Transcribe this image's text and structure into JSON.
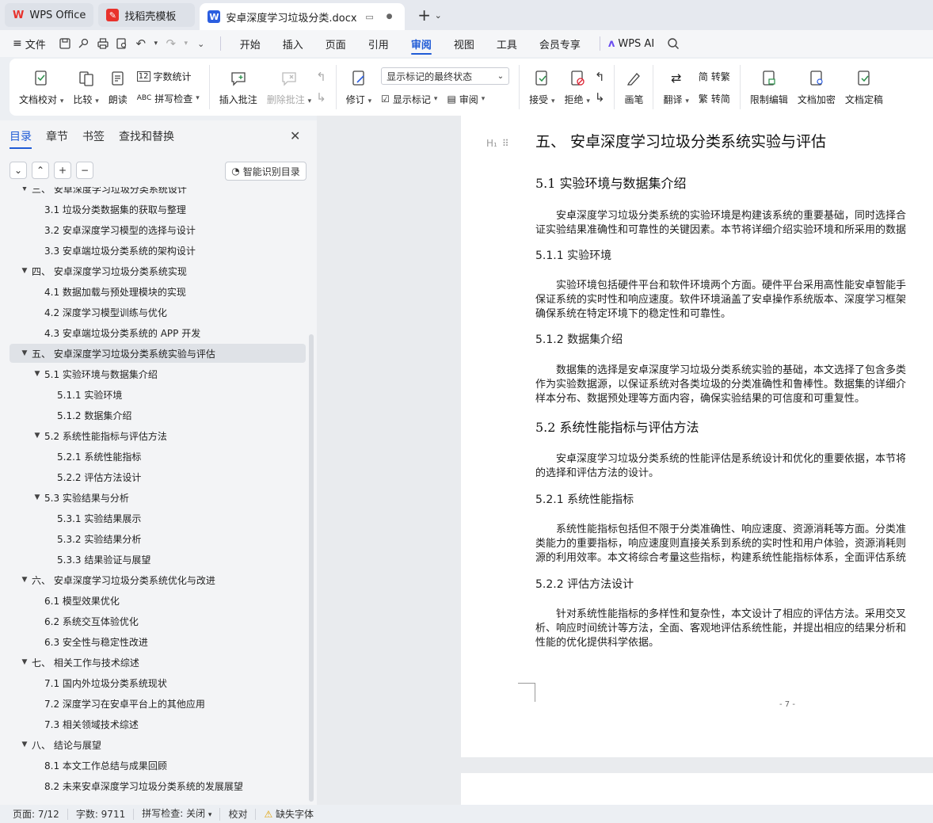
{
  "tabs": {
    "wps_office": "WPS Office",
    "templates": "找稻壳模板",
    "doc_title": "安卓深度学习垃圾分类.docx"
  },
  "menubar": {
    "file": "文件",
    "tabs": [
      "开始",
      "插入",
      "页面",
      "引用",
      "审阅",
      "视图",
      "工具",
      "会员专享"
    ],
    "active_tab": "审阅",
    "wps_ai": "WPS AI"
  },
  "ribbon": {
    "doc_check": "文档校对",
    "compare": "比较",
    "read_aloud": "朗读",
    "word_count": "字数统计",
    "spell_check": "拼写检查",
    "insert_comment": "插入批注",
    "delete_comment": "删除批注",
    "revise": "修订",
    "mark_state": "显示标记的最终状态",
    "show_marks": "显示标记",
    "review": "审阅",
    "accept": "接受",
    "reject": "拒绝",
    "brush": "画笔",
    "translate": "翻译",
    "to_traditional": "转繁",
    "to_simplified": "转简",
    "restrict_edit": "限制编辑",
    "encrypt": "文档加密",
    "finalize": "文档定稿"
  },
  "nav": {
    "tabs": [
      "目录",
      "章节",
      "书签",
      "查找和替换"
    ],
    "active": "目录",
    "smart_toc": "智能识别目录",
    "toc": [
      {
        "level": 1,
        "text": "三、 安卓深度学习垃圾分类系统设计",
        "arrow": "down",
        "partial": true
      },
      {
        "level": 2,
        "text": "3.1 垃圾分类数据集的获取与整理"
      },
      {
        "level": 2,
        "text": "3.2 安卓深度学习模型的选择与设计"
      },
      {
        "level": 2,
        "text": "3.3 安卓端垃圾分类系统的架构设计"
      },
      {
        "level": 1,
        "text": "四、 安卓深度学习垃圾分类系统实现",
        "arrow": "down"
      },
      {
        "level": 2,
        "text": "4.1 数据加载与预处理模块的实现"
      },
      {
        "level": 2,
        "text": "4.2 深度学习模型训练与优化"
      },
      {
        "level": 2,
        "text": "4.3 安卓端垃圾分类系统的 APP 开发"
      },
      {
        "level": 1,
        "text": "五、 安卓深度学习垃圾分类系统实验与评估",
        "arrow": "down",
        "selected": true
      },
      {
        "level": 2,
        "text": "5.1 实验环境与数据集介绍",
        "arrow": "down"
      },
      {
        "level": 3,
        "text": "5.1.1 实验环境"
      },
      {
        "level": 3,
        "text": "5.1.2 数据集介绍"
      },
      {
        "level": 2,
        "text": "5.2 系统性能指标与评估方法",
        "arrow": "down"
      },
      {
        "level": 3,
        "text": "5.2.1 系统性能指标"
      },
      {
        "level": 3,
        "text": "5.2.2 评估方法设计"
      },
      {
        "level": 2,
        "text": "5.3 实验结果与分析",
        "arrow": "down"
      },
      {
        "level": 3,
        "text": "5.3.1 实验结果展示"
      },
      {
        "level": 3,
        "text": "5.3.2 实验结果分析"
      },
      {
        "level": 3,
        "text": "5.3.3 结果验证与展望"
      },
      {
        "level": 1,
        "text": "六、 安卓深度学习垃圾分类系统优化与改进",
        "arrow": "down"
      },
      {
        "level": 2,
        "text": "6.1 模型效果优化"
      },
      {
        "level": 2,
        "text": "6.2 系统交互体验优化"
      },
      {
        "level": 2,
        "text": "6.3 安全性与稳定性改进"
      },
      {
        "level": 1,
        "text": "七、 相关工作与技术综述",
        "arrow": "down"
      },
      {
        "level": 2,
        "text": "7.1 国内外垃圾分类系统现状"
      },
      {
        "level": 2,
        "text": "7.2 深度学习在安卓平台上的其他应用"
      },
      {
        "level": 2,
        "text": "7.3 相关领域技术综述"
      },
      {
        "level": 1,
        "text": "八、 结论与展望",
        "arrow": "down"
      },
      {
        "level": 2,
        "text": "8.1 本文工作总结与成果回顾"
      },
      {
        "level": 2,
        "text": "8.2 未来安卓深度学习垃圾分类系统的发展展望"
      }
    ]
  },
  "document": {
    "chapter": "五、 安卓深度学习垃圾分类系统实验与评估",
    "s51": "5.1 实验环境与数据集介绍",
    "p51": [
      "安卓深度学习垃圾分类系统的实验环境是构建该系统的重要基础，同时选择合",
      "证实验结果准确性和可靠性的关键因素。本节将详细介绍实验环境和所采用的数据"
    ],
    "s511": "5.1.1 实验环境",
    "p511": [
      "实验环境包括硬件平台和软件环境两个方面。硬件平台采用高性能安卓智能手",
      "保证系统的实时性和响应速度。软件环境涵盖了安卓操作系统版本、深度学习框架",
      "确保系统在特定环境下的稳定性和可靠性。"
    ],
    "s512": "5.1.2 数据集介绍",
    "p512": [
      "数据集的选择是安卓深度学习垃圾分类系统实验的基础，本文选择了包含多类",
      "作为实验数据源，以保证系统对各类垃圾的分类准确性和鲁棒性。数据集的详细介",
      "样本分布、数据预处理等方面内容，确保实验结果的可信度和可重复性。"
    ],
    "s52": "5.2 系统性能指标与评估方法",
    "p52": [
      "安卓深度学习垃圾分类系统的性能评估是系统设计和优化的重要依据，本节将",
      "的选择和评估方法的设计。"
    ],
    "s521": "5.2.1 系统性能指标",
    "p521": [
      "系统性能指标包括但不限于分类准确性、响应速度、资源消耗等方面。分类准",
      "类能力的重要指标，响应速度则直接关系到系统的实时性和用户体验，资源消耗则",
      "源的利用效率。本文将综合考量这些指标，构建系统性能指标体系，全面评估系统"
    ],
    "s522": "5.2.2 评估方法设计",
    "p522": [
      "针对系统性能指标的多样性和复杂性，本文设计了相应的评估方法。采用交叉",
      "析、响应时间统计等方法，全面、客观地评估系统性能，并提出相应的结果分析和",
      "性能的优化提供科学依据。"
    ],
    "page_number": "- 7 -"
  },
  "status": {
    "page": "页面: 7/12",
    "words": "字数: 9711",
    "spell": "拼写检查: 关闭",
    "proof": "校对",
    "missing_font": "缺失字体"
  },
  "colors": {
    "accent": "#1f5bd6",
    "wps_red": "#e8322c",
    "doc_blue": "#2b5ee0"
  }
}
